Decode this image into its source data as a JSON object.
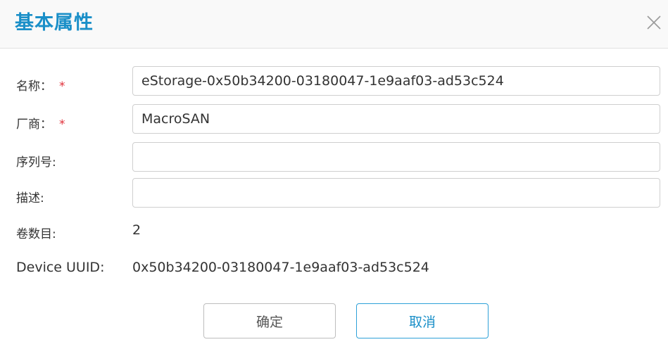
{
  "dialog": {
    "title": "基本属性",
    "close_icon": "close-icon"
  },
  "fields": {
    "name": {
      "label": "名称：",
      "required_mark": "*",
      "value": "eStorage-0x50b34200-03180047-1e9aaf03-ad53c524"
    },
    "vendor": {
      "label": "厂商：",
      "required_mark": "*",
      "value": "MacroSAN"
    },
    "serial": {
      "label": "序列号:",
      "value": ""
    },
    "description": {
      "label": "描述:",
      "value": ""
    },
    "volume_count": {
      "label": "卷数目:",
      "value": "2"
    },
    "device_uuid": {
      "label": "Device UUID:",
      "value": "0x50b34200-03180047-1e9aaf03-ad53c524"
    }
  },
  "buttons": {
    "ok_label": "确定",
    "cancel_label": "取消"
  },
  "colors": {
    "accent": "#1a8fc8",
    "required": "#e0303a"
  }
}
